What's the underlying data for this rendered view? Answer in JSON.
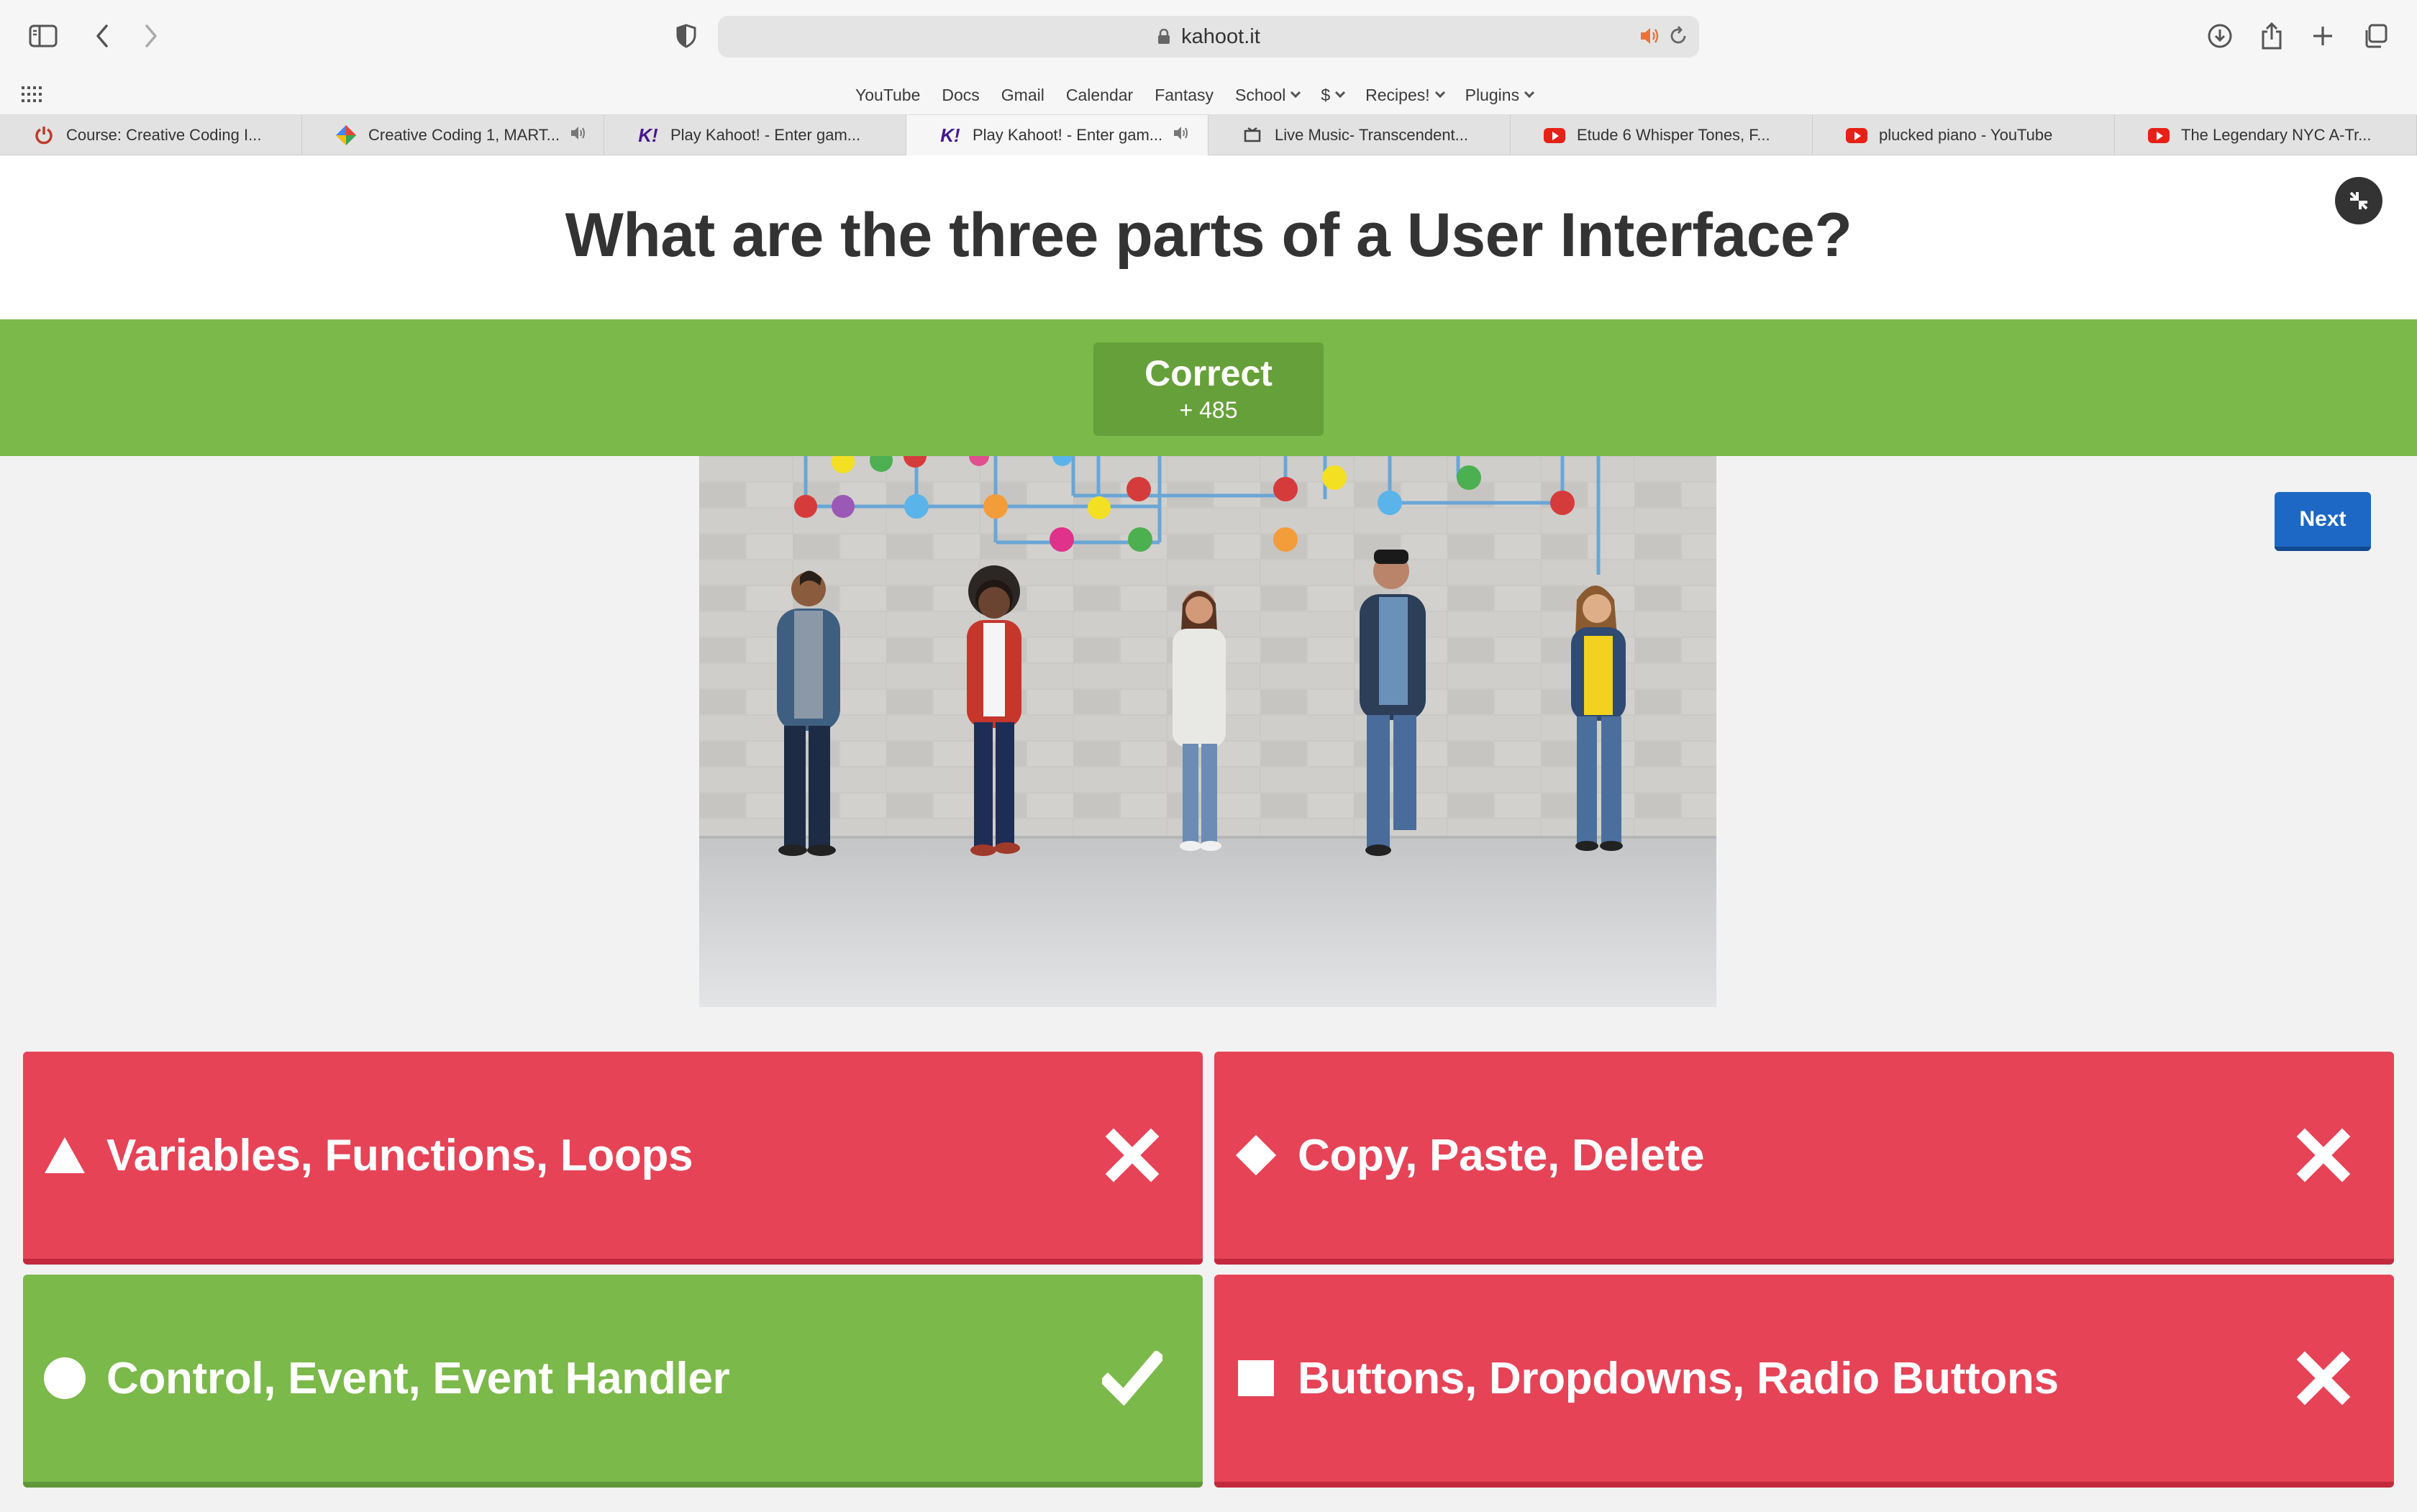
{
  "browser": {
    "url": "kahoot.it",
    "bookmarks": [
      "YouTube",
      "Docs",
      "Gmail",
      "Calendar",
      "Fantasy",
      "School",
      "$",
      "Recipes!",
      "Plugins"
    ],
    "bookmarks_with_menu": [
      "School",
      "$",
      "Recipes!",
      "Plugins"
    ],
    "tabs": [
      {
        "title": "Course: Creative Coding I...",
        "icon": "power-icon",
        "speaker": false,
        "active": false
      },
      {
        "title": "Creative Coding 1, MART...",
        "icon": "diamond-color-icon",
        "speaker": true,
        "active": false
      },
      {
        "title": "Play Kahoot! - Enter gam...",
        "icon": "kahoot-icon",
        "speaker": false,
        "active": false
      },
      {
        "title": "Play Kahoot! - Enter gam...",
        "icon": "kahoot-icon",
        "speaker": true,
        "active": true
      },
      {
        "title": "Live Music- Transcendent...",
        "icon": "music-icon",
        "speaker": false,
        "active": false
      },
      {
        "title": "Etude 6 Whisper Tones, F...",
        "icon": "youtube-icon",
        "speaker": false,
        "active": false
      },
      {
        "title": "plucked piano - YouTube",
        "icon": "youtube-icon",
        "speaker": false,
        "active": false
      },
      {
        "title": "The Legendary NYC A-Tr...",
        "icon": "youtube-icon",
        "speaker": false,
        "active": false
      }
    ]
  },
  "quiz": {
    "question": "What are the three parts of a User Interface?",
    "result": {
      "title": "Correct",
      "points": "+ 485"
    },
    "next_label": "Next",
    "answers": [
      {
        "text": "Variables, Functions, Loops",
        "shape": "triangle-icon",
        "correct": false
      },
      {
        "text": "Copy, Paste, Delete",
        "shape": "diamond-icon",
        "correct": false
      },
      {
        "text": "Control, Event, Event Handler",
        "shape": "circle-icon",
        "correct": true
      },
      {
        "text": "Buttons, Dropdowns, Radio Buttons",
        "shape": "square-icon",
        "correct": false
      }
    ]
  },
  "colors": {
    "correct": "#7bb94a",
    "wrong": "#e64357",
    "next_button": "#1c68c4",
    "question_text": "#333333"
  }
}
